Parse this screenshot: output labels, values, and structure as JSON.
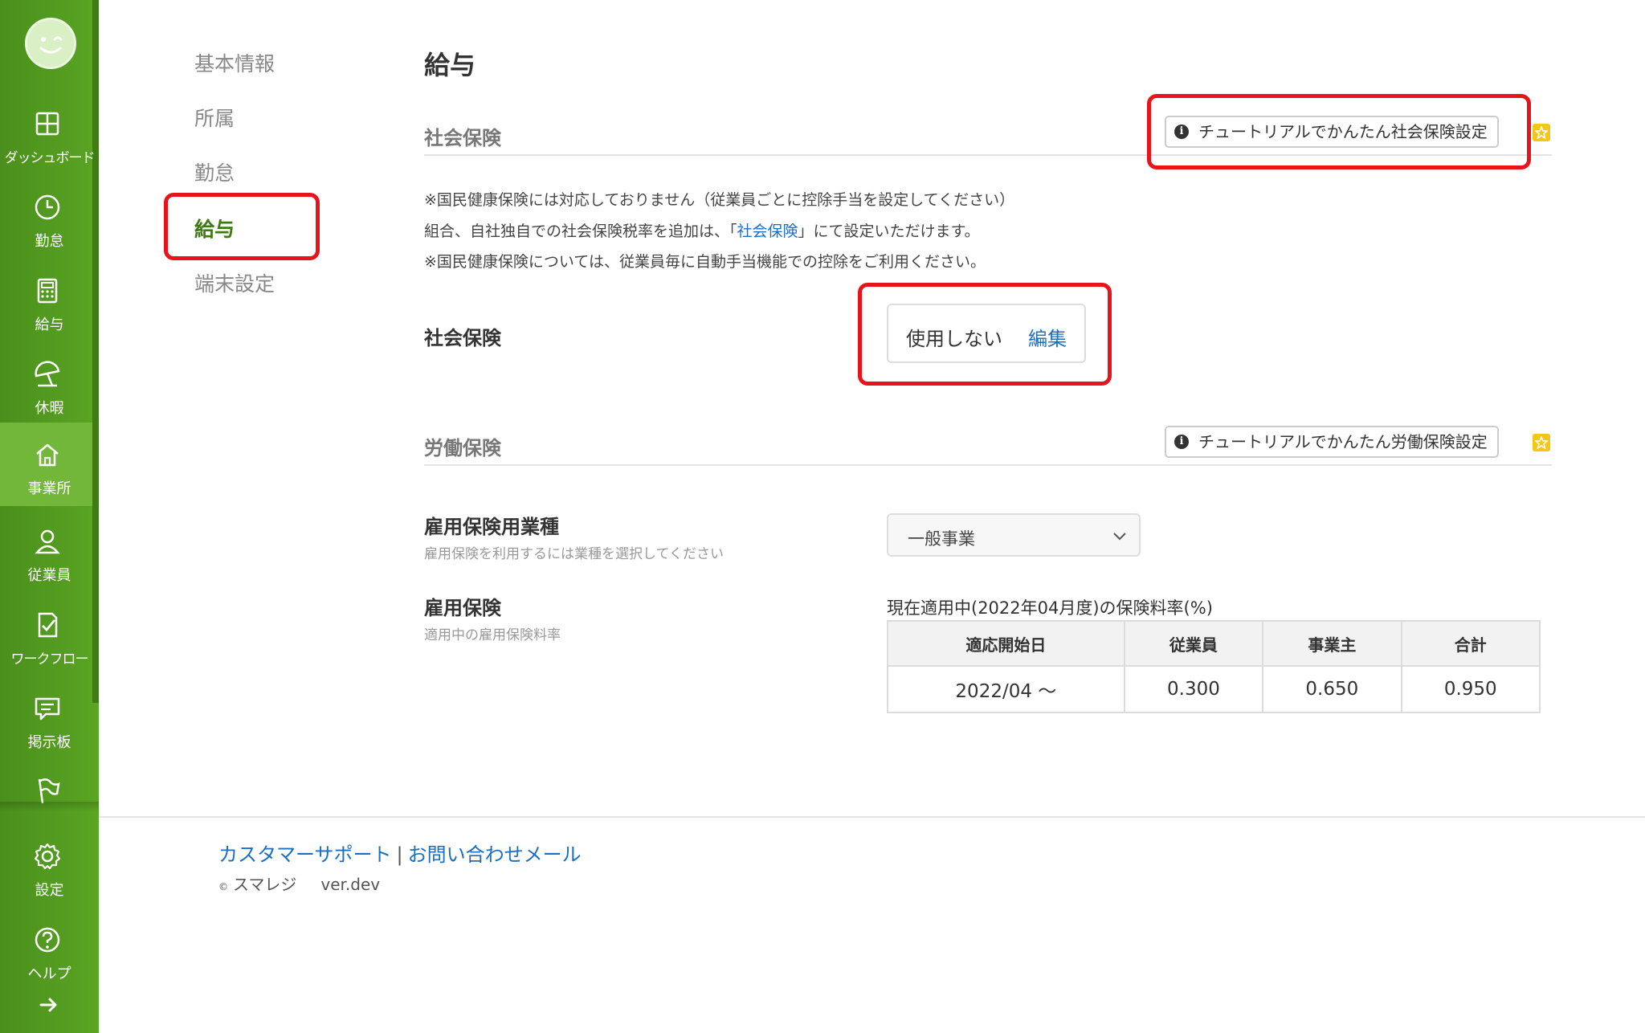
{
  "sidebar": {
    "items": [
      {
        "label": "ダッシュボード",
        "icon": "dashboard-icon"
      },
      {
        "label": "勤怠",
        "icon": "clock-icon"
      },
      {
        "label": "給与",
        "icon": "calculator-icon"
      },
      {
        "label": "休暇",
        "icon": "beach-umbrella-icon"
      },
      {
        "label": "事業所",
        "icon": "home-icon"
      },
      {
        "label": "従業員",
        "icon": "person-icon"
      },
      {
        "label": "ワークフロー",
        "icon": "checklist-icon"
      },
      {
        "label": "掲示板",
        "icon": "message-board-icon"
      },
      {
        "label": "",
        "icon": "flag-icon"
      },
      {
        "label": "設定",
        "icon": "gear-icon"
      },
      {
        "label": "ヘルプ",
        "icon": "help-icon"
      }
    ],
    "active": "事業所"
  },
  "subnav": {
    "items": [
      "基本情報",
      "所属",
      "勤怠",
      "給与",
      "端末設定"
    ],
    "active": "給与"
  },
  "main": {
    "title": "給与",
    "social_insurance": {
      "heading": "社会保険",
      "tutorial_button": "チュートリアルでかんたん社会保険設定",
      "notes": {
        "line1": "※国民健康保険には対応しておりません（従業員ごとに控除手当を設定してください）",
        "line2_pre": "組合、自社独自での社会保険税率を追加は、「",
        "line2_link": "社会保険",
        "line2_post": "」にて設定いただけます。",
        "line3": "※国民健康保険については、従業員毎に自動手当機能での控除をご利用ください。"
      },
      "field_label": "社会保険",
      "status_value": "使用しない",
      "edit_label": "編集"
    },
    "labor_insurance": {
      "heading": "労働保険",
      "tutorial_button": "チュートリアルでかんたん労働保険設定",
      "business_type_label": "雇用保険用業種",
      "business_type_sub": "雇用保険を利用するには業種を選択してください",
      "business_type_value": "一般事業",
      "employment_label": "雇用保険",
      "employment_sub": "適用中の雇用保険料率",
      "rate_caption": "現在適用中(2022年04月度)の保険料率(%)",
      "table": {
        "headers": [
          "適応開始日",
          "従業員",
          "事業主",
          "合計"
        ],
        "row": [
          "2022/04 〜",
          "0.300",
          "0.650",
          "0.950"
        ]
      }
    }
  },
  "footer": {
    "support_link": "カスタマーサポート",
    "separator": "|",
    "mail_link": "お問い合わせメール",
    "copyright_symbol": "©",
    "company": "スマレジ",
    "version": "ver.dev"
  },
  "colors": {
    "sidebar_green": "#5aa523",
    "active_green": "#3e7a12",
    "highlight_red": "#e8141b",
    "link_blue": "#1a6fc2"
  }
}
